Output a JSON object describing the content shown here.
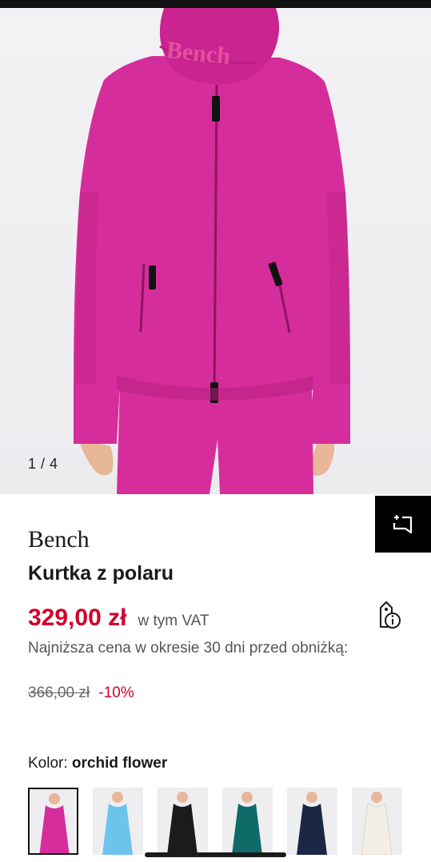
{
  "gallery": {
    "counter": "1 / 4",
    "image_alt": "Pink fleece jacket with high collar, Bench logo",
    "collar_logo": "Bench",
    "colors": {
      "fleece": "#d62d9c",
      "fleece_shade": "#b8207f",
      "background": "#eeeef0",
      "skin": "#e8b79a"
    }
  },
  "actions": {
    "save_icon": "add-to-wishlist-icon"
  },
  "product": {
    "brand": "Bench",
    "name": "Kurtka z polaru",
    "price": "329,00 zł",
    "vat_note": "w tym VAT",
    "price_info_icon": "price-tag-info-icon",
    "lowest_price_label": "Najniższa cena w okresie 30 dni przed obniżką:",
    "old_price": "366,00 zł",
    "discount": "-10%"
  },
  "color": {
    "label": "Kolor:",
    "value": "orchid flower",
    "swatches": [
      {
        "name": "orchid flower",
        "hex": "#d62d9c",
        "selected": true
      },
      {
        "name": "light blue",
        "hex": "#6cc4ec",
        "selected": false
      },
      {
        "name": "black",
        "hex": "#1b1b1d",
        "selected": false
      },
      {
        "name": "dark teal",
        "hex": "#0f6b67",
        "selected": false
      },
      {
        "name": "navy",
        "hex": "#1c2745",
        "selected": false
      },
      {
        "name": "cream",
        "hex": "#f3efe6",
        "selected": false
      }
    ]
  },
  "theme": {
    "accent": "#d1002c",
    "text": "#1a1a1a",
    "muted": "#555555"
  }
}
